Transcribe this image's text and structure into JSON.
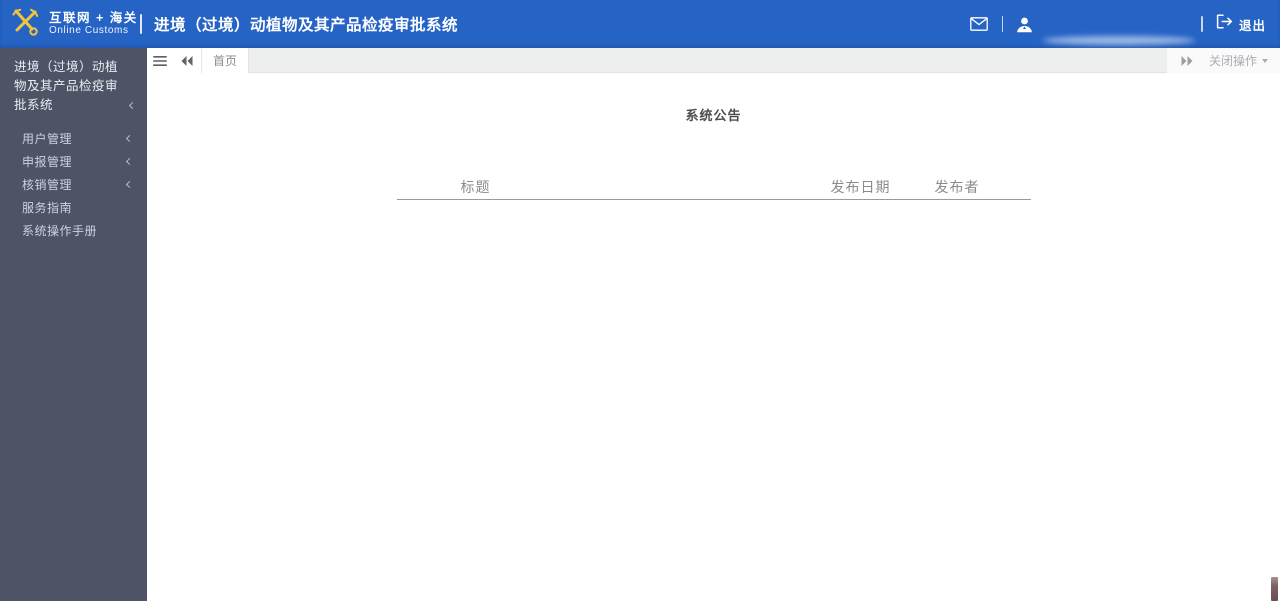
{
  "colors": {
    "header_blue": "#2563c5",
    "sidebar_bg": "#4e5465",
    "emblem_gold": "#f2c63c",
    "tab_strip_gray": "#edefef",
    "table_header_text": "#8b8b8b"
  },
  "header": {
    "logo_line1": "互联网 + 海关",
    "logo_line2": "Online Customs",
    "title": "进境（过境）动植物及其产品检疫审批系统",
    "logout_label": "退出",
    "icons": [
      "customs-emblem-icon",
      "mail-icon",
      "user-icon",
      "logout-icon"
    ]
  },
  "sidebar": {
    "title": "进境（过境）动植物及其产品检疫审批系统",
    "items": [
      {
        "label": "用户管理",
        "has_submenu": true
      },
      {
        "label": "申报管理",
        "has_submenu": true
      },
      {
        "label": "核销管理",
        "has_submenu": true
      },
      {
        "label": "服务指南",
        "has_submenu": false
      },
      {
        "label": "系统操作手册",
        "has_submenu": false
      }
    ]
  },
  "tabbar": {
    "tabs": [
      {
        "label": "首页",
        "active": true
      }
    ],
    "close_menu_label": "关闭操作",
    "icons": [
      "hamburger-icon",
      "double-arrow-left-icon",
      "double-arrow-right-icon",
      "caret-down-icon"
    ]
  },
  "main": {
    "title": "系统公告",
    "table": {
      "columns": [
        "标题",
        "发布日期",
        "发布者"
      ],
      "rows": []
    }
  }
}
